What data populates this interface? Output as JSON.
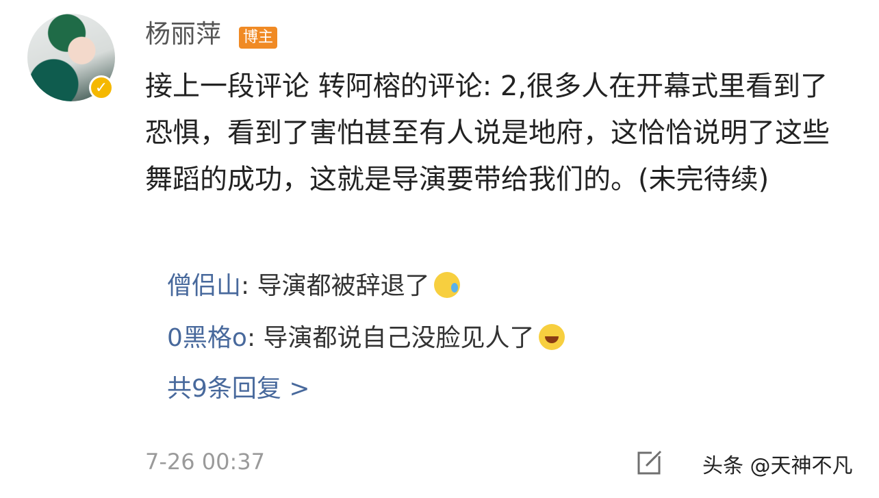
{
  "post": {
    "username": "杨丽萍",
    "badge": "博主",
    "content": "接上一段评论 转阿榕的评论: 2,很多人在开幕式里看到了恐惧，看到了害怕甚至有人说是地府，这恰恰说明了这些舞蹈的成功，这就是导演要带给我们的。(未完待续)",
    "timestamp": "7-26 00:37"
  },
  "replies": [
    {
      "user": "僧侣山",
      "sep": ": ",
      "text": "导演都被辞退了",
      "emoji": "sweat-emoji"
    },
    {
      "user": "0黑格o",
      "sep": ": ",
      "text": "导演都说自己没脸见人了",
      "emoji": "laugh-cry-emoji"
    }
  ],
  "more_replies": "共9条回复 >",
  "watermark": "头条 @天神不凡",
  "icons": {
    "avatar_badge": "verified-icon",
    "edit": "edit-icon"
  },
  "colors": {
    "link": "#48699c",
    "badge": "#f08a24",
    "verified": "#f5b800"
  }
}
